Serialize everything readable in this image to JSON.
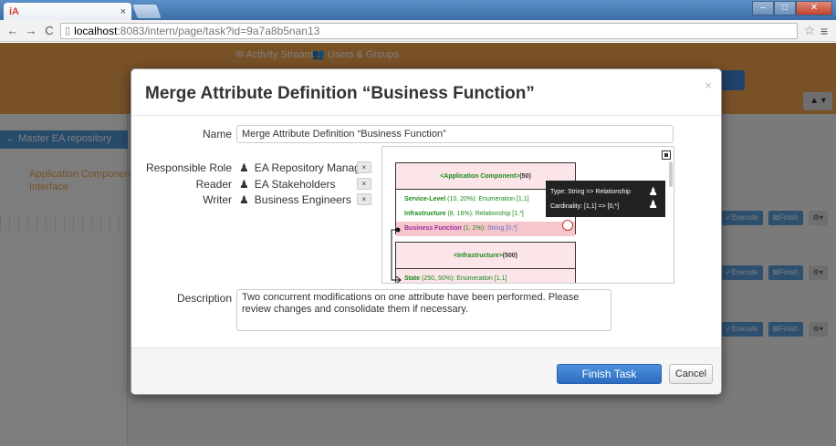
{
  "browser": {
    "tab_favicon": "iA",
    "tab_close": "×",
    "url_host": "localhost",
    "url_rest": ":8083/intern/page/task?id=9a7a8b5nan13",
    "icons": {
      "back": "back-arrow-icon",
      "forward": "forward-arrow-icon",
      "reload": "reload-icon",
      "page": "page-icon",
      "star": "star-icon",
      "menu": "menu-icon"
    }
  },
  "background": {
    "nav_activity": "✉ Activity Stream",
    "nav_users": "👥 Users & Groups",
    "sidebar_header": "← Master EA repository",
    "sidebar_item1": "Application Component",
    "sidebar_item2": "Interface"
  },
  "modal": {
    "title": "Merge Attribute Definition “Business Function”",
    "close": "×",
    "labels": {
      "name": "Name",
      "responsible": "Responsible Role",
      "reader": "Reader",
      "writer": "Writer",
      "description": "Description"
    },
    "name_value": "Merge Attribute Definition “Business Function”",
    "roles": [
      {
        "name": "EA Repository Manager",
        "remove": "×"
      },
      {
        "name": "EA Stakeholders",
        "remove": "×"
      },
      {
        "name": "Business Engineers",
        "remove": "×"
      }
    ],
    "description_value": "Two concurrent modifications on one attribute have been performed. Please review changes and consolidate them if necessary.",
    "finish_label": "Finish Task",
    "cancel_label": "Cancel"
  },
  "diagram": {
    "box1": {
      "stereotype": "<Application Component>",
      "count": " (50)",
      "attributes": [
        {
          "name": "Service-Level",
          "card": " (10, 20%): ",
          "type": "Enumeration [1,1]"
        },
        {
          "name": "Infrastructure",
          "card": " (8, 16%): ",
          "type": "Relationship [1,*]"
        },
        {
          "name": "Business Function",
          "card": " (1, 2%): ",
          "type": "String [0,*]"
        }
      ]
    },
    "box2": {
      "stereotype": "<Infrastructure>",
      "count": " (500)",
      "attributes": [
        {
          "name": "State",
          "card": " (250, 50%): ",
          "type": "Enumeration [1,1]"
        }
      ]
    },
    "tooltip": {
      "line1": "Type: String => Relationship",
      "line2": "Cardinality: [1,1]  => [0,*]"
    }
  }
}
